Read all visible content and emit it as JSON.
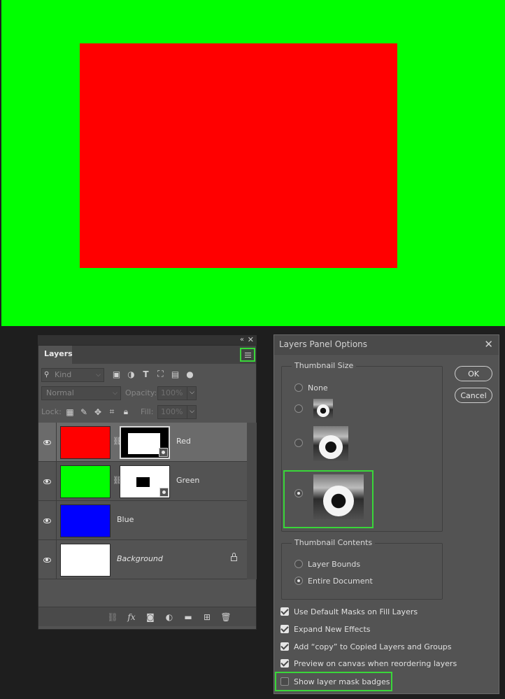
{
  "canvas": {
    "background_color": "#00ff00",
    "rect_color": "#ff0000"
  },
  "panel_header": {
    "collapse_icon": "«",
    "close_icon": "✕"
  },
  "layers_panel": {
    "tab_label": "Layers",
    "filter": {
      "kind_placeholder": "Kind"
    },
    "blend_mode": "Normal",
    "opacity_label": "Opacity:",
    "opacity_value": "100%",
    "lock_label": "Lock:",
    "fill_label": "Fill:",
    "fill_value": "100%",
    "layers": [
      {
        "name": "Red",
        "color": "#ff0000",
        "italic": false,
        "has_mask": true,
        "selected": true
      },
      {
        "name": "Green",
        "color": "#00ff00",
        "italic": false,
        "has_mask": true,
        "selected": false
      },
      {
        "name": "Blue",
        "color": "#0000ff",
        "italic": false,
        "has_mask": false,
        "selected": false
      },
      {
        "name": "Background",
        "color": "#ffffff",
        "italic": true,
        "has_mask": false,
        "locked": true,
        "selected": false
      }
    ]
  },
  "dialog": {
    "title": "Layers Panel Options",
    "thumbnail_size": {
      "label": "Thumbnail Size",
      "none_label": "None",
      "selected": "large"
    },
    "thumbnail_contents": {
      "label": "Thumbnail Contents",
      "options": [
        "Layer Bounds",
        "Entire Document"
      ],
      "selected": "Entire Document"
    },
    "ok_label": "OK",
    "cancel_label": "Cancel",
    "checkboxes": [
      {
        "label": "Use Default Masks on Fill Layers",
        "checked": true
      },
      {
        "label": "Expand New Effects",
        "checked": true
      },
      {
        "label": "Add “copy” to Copied Layers and Groups",
        "checked": true
      },
      {
        "label": "Preview on canvas when reordering layers",
        "checked": true
      },
      {
        "label": "Show layer mask badges",
        "checked": false
      }
    ]
  },
  "accent_color": "#39d639"
}
